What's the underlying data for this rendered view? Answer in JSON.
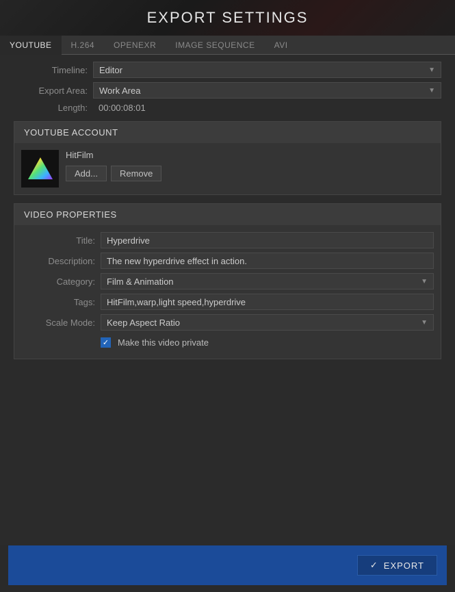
{
  "app_title": "EXPORT SETTINGS",
  "tabs": {
    "youtube": "YOUTUBE",
    "h264": "H.264",
    "openexr": "OPENEXR",
    "image_sequence": "IMAGE SEQUENCE",
    "avi": "AVI"
  },
  "main": {
    "timeline_label": "Timeline:",
    "timeline_value": "Editor",
    "export_area_label": "Export Area:",
    "export_area_value": "Work Area",
    "length_label": "Length:",
    "length_value": "00:00:08:01"
  },
  "youtube_account": {
    "header": "YOUTUBE ACCOUNT",
    "name": "HitFilm",
    "add_label": "Add...",
    "remove_label": "Remove"
  },
  "video_properties": {
    "header": "VIDEO PROPERTIES",
    "title_label": "Title:",
    "title_value": "Hyperdrive",
    "description_label": "Description:",
    "description_value": "The new hyperdrive effect in action.",
    "category_label": "Category:",
    "category_value": "Film & Animation",
    "tags_label": "Tags:",
    "tags_value": "HitFilm,warp,light speed,hyperdrive",
    "scale_mode_label": "Scale Mode:",
    "scale_mode_value": "Keep Aspect Ratio",
    "private_label": "Make this video private",
    "private_checked": true
  },
  "footer": {
    "export_label": "EXPORT"
  },
  "colors": {
    "accent_blue": "#1b4b99",
    "checkbox_blue": "#2264b8"
  }
}
